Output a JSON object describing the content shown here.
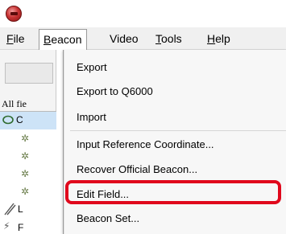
{
  "menubar": {
    "items": [
      {
        "label": "File",
        "key": "F",
        "rest": "ile"
      },
      {
        "label": "Beacon",
        "key": "B",
        "rest": "eacon"
      },
      {
        "label": "Video",
        "key": "",
        "rest": "Video"
      },
      {
        "label": "Tools",
        "key": "T",
        "rest": "ools"
      },
      {
        "label": "Help",
        "key": "H",
        "rest": "elp"
      }
    ]
  },
  "left_panel": {
    "filter_label": "All fie",
    "tree": {
      "root_text": "C",
      "lower_text_1": "L",
      "lower_text_2": "F"
    }
  },
  "beacon_menu": {
    "items": [
      {
        "label": "Export"
      },
      {
        "label": "Export to Q6000"
      },
      {
        "label": "Import"
      },
      {
        "label": "Input Reference Coordinate..."
      },
      {
        "label": "Recover Official Beacon..."
      },
      {
        "label": "Edit Field..."
      },
      {
        "label": "Beacon Set..."
      }
    ]
  },
  "colors": {
    "highlight": "#e0081c",
    "menu_background": "#f7f7f7",
    "tree_selection": "#cde3f7"
  }
}
